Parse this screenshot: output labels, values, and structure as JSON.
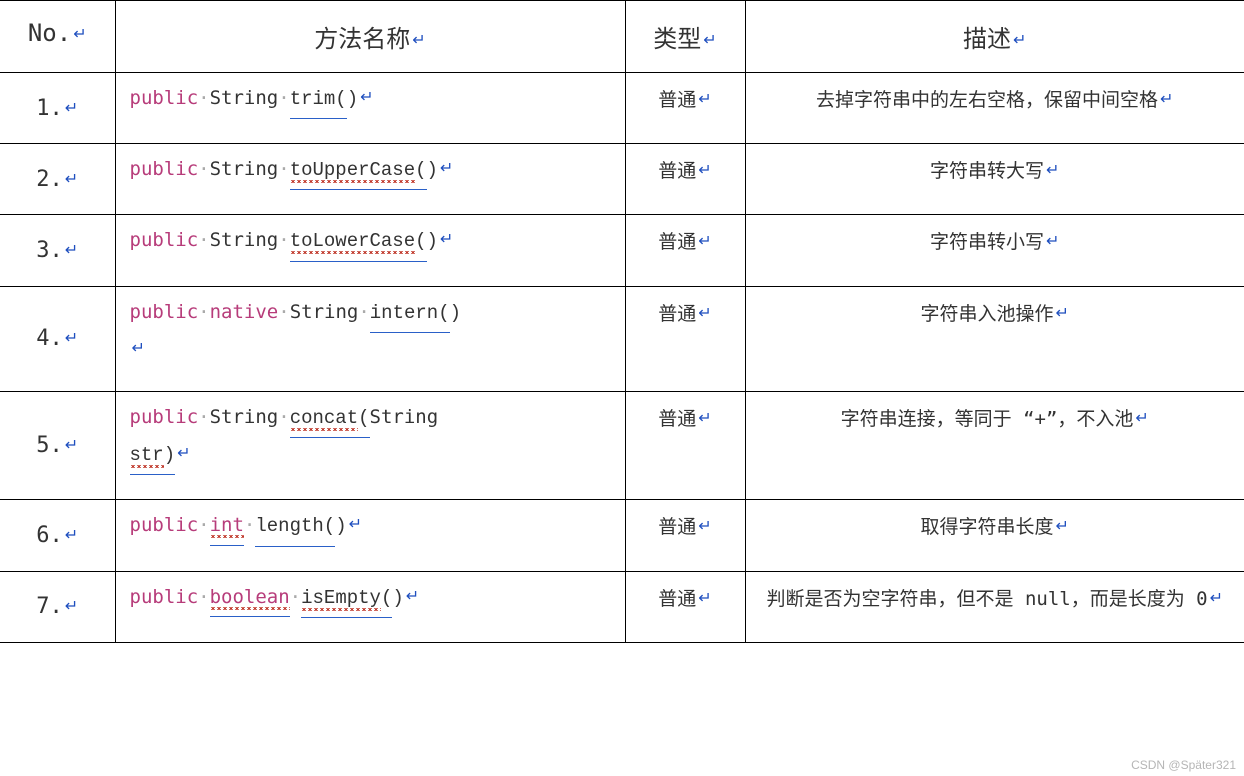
{
  "headers": {
    "no": "No.",
    "name": "方法名称",
    "type": "类型",
    "desc": "描述"
  },
  "dot": "·",
  "enter": "↵",
  "paren_open": "(",
  "paren_close": ")",
  "rows": [
    {
      "no": "1.",
      "tokens": {
        "kw1": "public",
        "type1": "String",
        "method": "trim"
      },
      "type": "普通",
      "desc": "去掉字符串中的左右空格，保留中间空格"
    },
    {
      "no": "2.",
      "tokens": {
        "kw1": "public",
        "type1": "String",
        "method": "toUpperCase"
      },
      "type": "普通",
      "desc": "字符串转大写"
    },
    {
      "no": "3.",
      "tokens": {
        "kw1": "public",
        "type1": "String",
        "method": "toLowerCase"
      },
      "type": "普通",
      "desc": "字符串转小写"
    },
    {
      "no": "4.",
      "tokens": {
        "kw1": "public",
        "kw2": "native",
        "type1": "String",
        "method": "intern"
      },
      "type": "普通",
      "desc": "字符串入池操作"
    },
    {
      "no": "5.",
      "tokens": {
        "kw1": "public",
        "type1": "String",
        "method": "concat",
        "argtype": "String",
        "argname": "str"
      },
      "type": "普通",
      "desc": "字符串连接，等同于 “+”，不入池"
    },
    {
      "no": "6.",
      "tokens": {
        "kw1": "public",
        "kw2": "int",
        "method": "length"
      },
      "type": "普通",
      "desc": "取得字符串长度"
    },
    {
      "no": "7.",
      "tokens": {
        "kw1": "public",
        "kw2": "boolean",
        "method": "isEmpty"
      },
      "type": "普通",
      "desc": "判断是否为空字符串，但不是 null，而是长度为 0"
    }
  ],
  "watermark": "CSDN @Später321"
}
